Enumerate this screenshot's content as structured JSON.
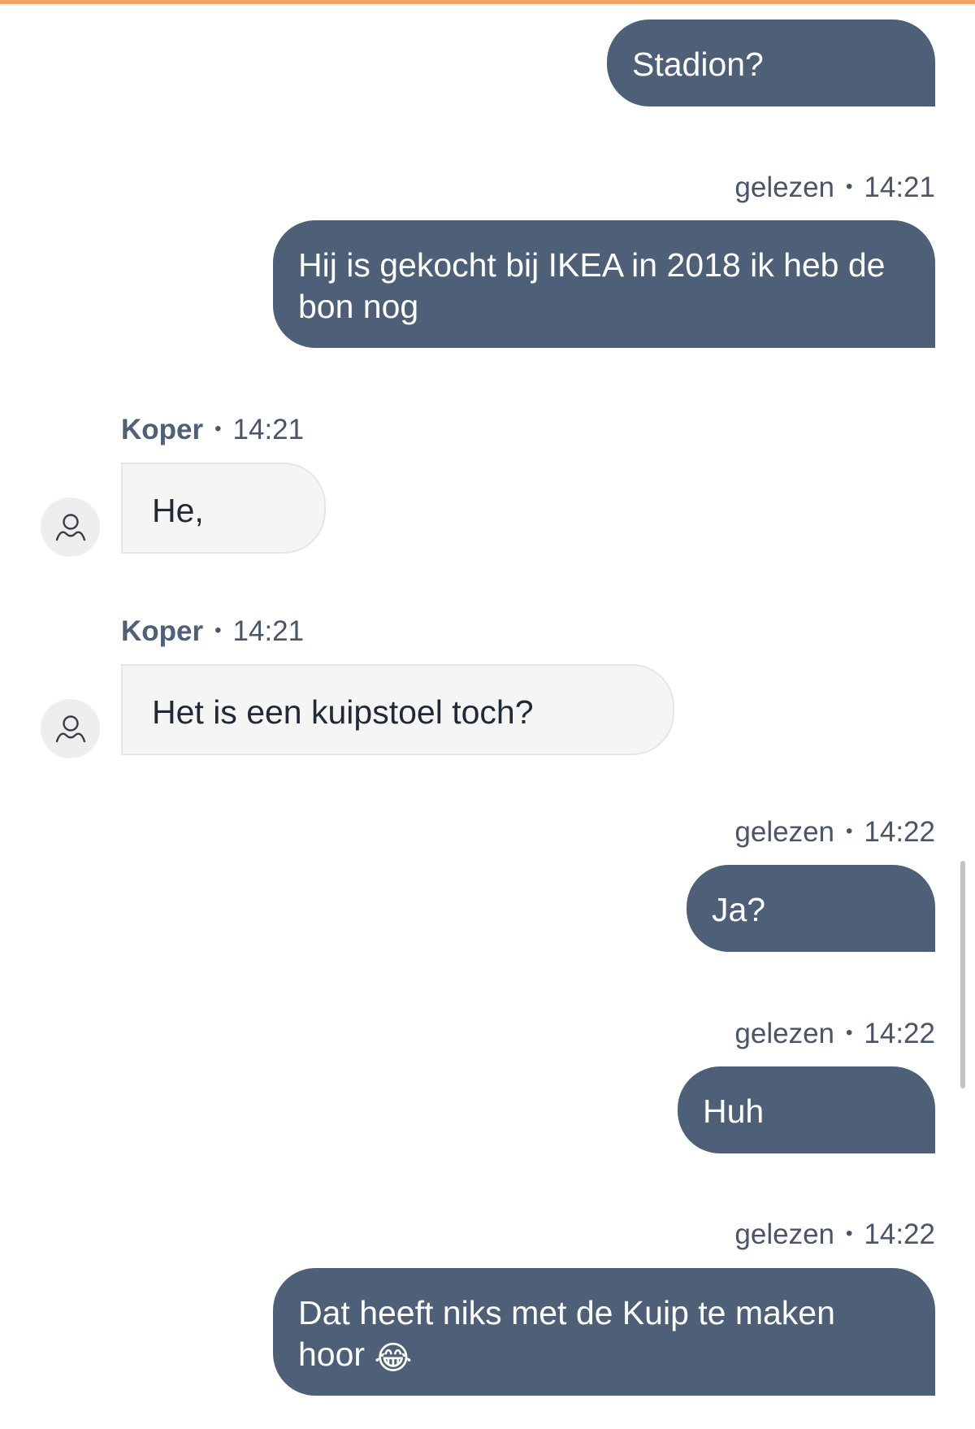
{
  "colors": {
    "accent_top_bar": "#f4a461",
    "outgoing_bubble": "#4e6078",
    "incoming_bubble": "#f5f5f4",
    "meta_text": "#4a5568"
  },
  "messages": [
    {
      "direction": "outgoing",
      "text": "Stadion?"
    },
    {
      "direction": "outgoing",
      "status": "gelezen",
      "time": "14:21",
      "text": "Hij is gekocht bij IKEA in 2018 ik heb de bon nog"
    },
    {
      "direction": "incoming",
      "sender": "Koper",
      "time": "14:21",
      "text": "He,",
      "avatar_icon": "user-icon"
    },
    {
      "direction": "incoming",
      "sender": "Koper",
      "time": "14:21",
      "text": "Het is een kuipstoel toch?",
      "avatar_icon": "user-icon"
    },
    {
      "direction": "outgoing",
      "status": "gelezen",
      "time": "14:22",
      "text": "Ja?"
    },
    {
      "direction": "outgoing",
      "status": "gelezen",
      "time": "14:22",
      "text": "Huh"
    },
    {
      "direction": "outgoing",
      "status": "gelezen",
      "time": "14:22",
      "text": "Dat heeft niks met de Kuip te maken hoor",
      "emoji": "😂",
      "emoji_icon": "laughing-tears-emoji-icon"
    }
  ],
  "meta_separator": "•"
}
